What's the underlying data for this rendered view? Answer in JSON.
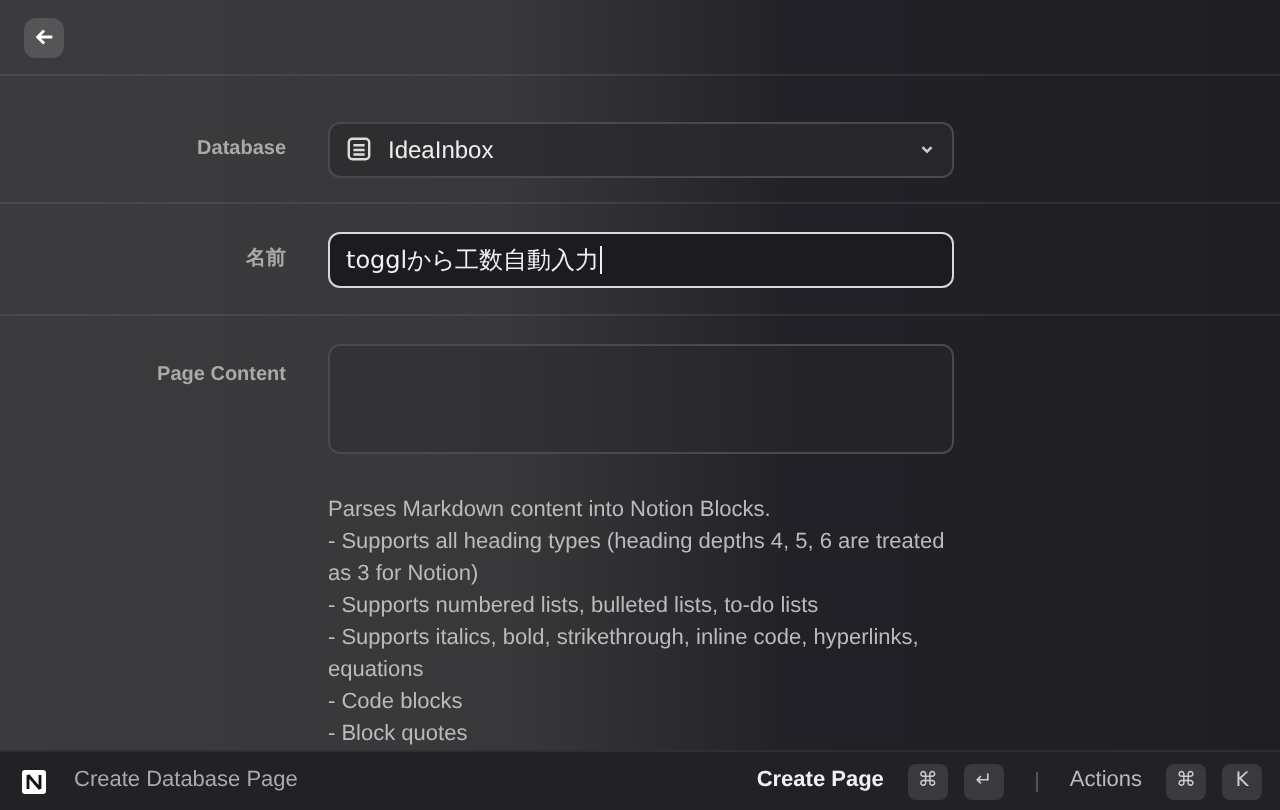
{
  "fields": [
    {
      "kind": "dropdown",
      "label": "Database",
      "value": "IdeaInbox"
    },
    {
      "kind": "text",
      "label": "名前",
      "value": "togglから工数自動入力",
      "focused": true
    },
    {
      "kind": "textarea",
      "label": "Page Content"
    }
  ],
  "description": [
    "Parses Markdown content into Notion Blocks.",
    "- Supports all heading types (heading depths 4, 5, 6 are treated as 3 for Notion)",
    "- Supports numbered lists, bulleted lists, to-do lists",
    "- Supports italics, bold, strikethrough, inline code, hyperlinks, equations",
    "- Code blocks",
    "- Block quotes"
  ],
  "footer": {
    "title": "Create Database Page",
    "primary_action": "Create Page",
    "primary_keys": [
      "⌘",
      "↵"
    ],
    "secondary_action": "Actions",
    "secondary_keys": [
      "⌘",
      "K"
    ]
  }
}
